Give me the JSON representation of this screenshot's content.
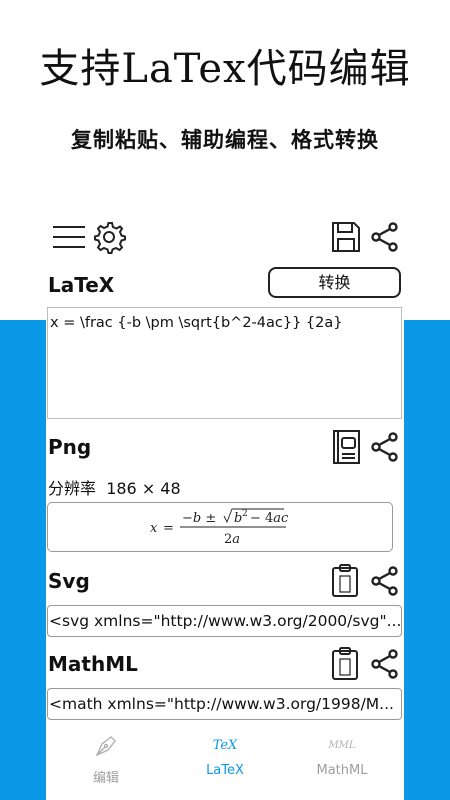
{
  "promo": {
    "headline": "支持LaTex代码编辑",
    "subheadline": "复制粘贴、辅助编程、格式转换"
  },
  "app": {
    "latex": {
      "title": "LaTeX",
      "convert_label": "转换",
      "input_value": "x = \\frac {-b \\pm \\sqrt{b^2-4ac}} {2a}"
    },
    "png": {
      "title": "Png",
      "resolution_label": "分辨率",
      "resolution_value": "186 × 48"
    },
    "svg": {
      "title": "Svg",
      "code": "<svg xmlns=\"http://www.w3.org/2000/svg\"..."
    },
    "mathml": {
      "title": "MathML",
      "code": "<math xmlns=\"http://www.w3.org/1998/M..."
    },
    "nav": {
      "items": [
        {
          "label": "编辑",
          "icon": "pen-nib-icon",
          "active": false
        },
        {
          "label": "LaTeX",
          "icon_text": "TeX",
          "active": true
        },
        {
          "label": "MathML",
          "icon_text": "MML",
          "active": false
        }
      ]
    }
  },
  "colors": {
    "band": "#0b98e6",
    "active_nav": "#0b98e6",
    "inactive_nav": "#9e9e9e"
  }
}
